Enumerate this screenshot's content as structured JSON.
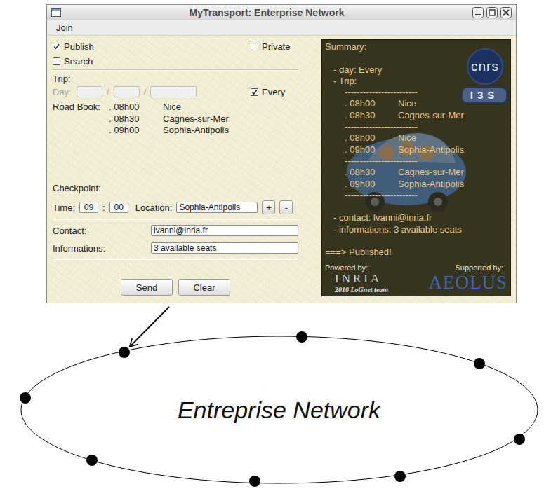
{
  "window": {
    "title": "MyTransport: Enterprise Network"
  },
  "menu": [
    {
      "label": "Join"
    }
  ],
  "form": {
    "publish": {
      "label": "Publish",
      "checked": true
    },
    "private": {
      "label": "Private",
      "checked": false
    },
    "search": {
      "label": "Search",
      "checked": false
    },
    "trip_label": "Trip:",
    "day": {
      "label": "Day:",
      "disabled": true,
      "fields": [
        "",
        "",
        ""
      ],
      "separator": "/"
    },
    "every": {
      "label": "Every",
      "checked": true
    },
    "road_book": {
      "label": "Road Book:",
      "entries": [
        {
          "time": ". 08h00",
          "place": "Nice"
        },
        {
          "time": ". 08h30",
          "place": "Cagnes-sur-Mer"
        },
        {
          "time": ". 09h00",
          "place": "Sophia-Antipolis"
        }
      ]
    },
    "checkpoint": {
      "label": "Checkpoint:",
      "time_label": "Time:",
      "hour": "09",
      "time_separator": ":",
      "minute": "00",
      "location_label": "Location:",
      "location": "Sophia-Antipolis",
      "add": "+",
      "remove": "-"
    },
    "contact": {
      "label": "Contact:",
      "value": "lvanni@inria.fr"
    },
    "informations": {
      "label": "Informations:",
      "value": "3 available seats"
    },
    "buttons": [
      {
        "label": "Send"
      },
      {
        "label": "Clear"
      }
    ]
  },
  "summary": {
    "title": "Summary:",
    "day": "- day: Every",
    "trip": "- Trip:",
    "separator": "------------------------",
    "segments": [
      [
        {
          "time": ". 08h00",
          "place": "Nice"
        },
        {
          "time": ". 08h30",
          "place": "Cagnes-sur-Mer"
        }
      ],
      [
        {
          "time": ". 08h00",
          "place": "Nice"
        },
        {
          "time": ". 09h00",
          "place": "Sophia-Antipolis"
        }
      ],
      [
        {
          "time": ". 08h30",
          "place": "Cagnes-sur-Mer"
        },
        {
          "time": ". 09h00",
          "place": "Sophia-Antipolis"
        }
      ]
    ],
    "contact": "- contact: lvanni@inria.fr",
    "informations": "- informations: 3 available seats",
    "status": "===> Published!",
    "powered_by": "Powered by:",
    "supported_by": "Supported by:",
    "logos": {
      "cnrs": "cnrs",
      "i3s": "I3S",
      "inria": "INRIA",
      "inria_caption": "2010 LoGnet team",
      "aeolus": "AEOLUS"
    }
  },
  "diagram": {
    "label": "Entreprise Network",
    "nodes": [
      {
        "connected": true
      },
      {
        "connected": false
      },
      {
        "connected": false
      },
      {
        "connected": false
      },
      {
        "connected": false
      },
      {
        "connected": false
      },
      {
        "connected": false
      },
      {
        "connected": false
      }
    ]
  }
}
